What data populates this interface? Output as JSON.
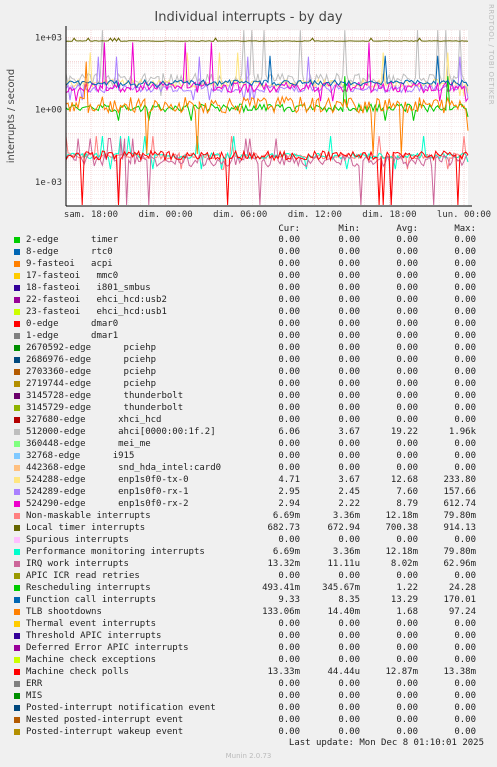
{
  "page": {
    "title": "Individual interrupts - by day",
    "side_label": "RRDTOOL / TOBI OETIKER",
    "last_update": "Last update: Mon Dec  8 01:10:01 2025",
    "munin": "Munin 2.0.73"
  },
  "legend_headers": {
    "cur": "Cur:",
    "min": "Min:",
    "avg": "Avg:",
    "max": "Max:"
  },
  "chart_data": {
    "type": "line",
    "title": "Individual interrupts - by day",
    "ylabel": "interrupts / second",
    "yscale": "log",
    "ylim": [
      0.0001,
      2000
    ],
    "yticks": [
      0.001,
      1,
      1000
    ],
    "ytick_labels": [
      "1e-03",
      "1e+00",
      "1e+03"
    ],
    "x_ticks": [
      "sam. 18:00",
      "dim. 00:00",
      "dim. 06:00",
      "dim. 12:00",
      "dim. 18:00",
      "lun. 00:00"
    ],
    "grid": true,
    "legend_position": "bottom",
    "series": [
      {
        "name": "2-edge      timer",
        "color": "#00cc00",
        "cur": "0.00",
        "min": "0.00",
        "avg": "0.00",
        "max": "0.00"
      },
      {
        "name": "8-edge      rtc0",
        "color": "#0066b3",
        "cur": "0.00",
        "min": "0.00",
        "avg": "0.00",
        "max": "0.00"
      },
      {
        "name": "9-fasteoi   acpi",
        "color": "#ff8000",
        "cur": "0.00",
        "min": "0.00",
        "avg": "0.00",
        "max": "0.00"
      },
      {
        "name": "17-fasteoi   mmc0",
        "color": "#ffcc00",
        "cur": "0.00",
        "min": "0.00",
        "avg": "0.00",
        "max": "0.00"
      },
      {
        "name": "18-fasteoi   i801_smbus",
        "color": "#330099",
        "cur": "0.00",
        "min": "0.00",
        "avg": "0.00",
        "max": "0.00"
      },
      {
        "name": "22-fasteoi   ehci_hcd:usb2",
        "color": "#990099",
        "cur": "0.00",
        "min": "0.00",
        "avg": "0.00",
        "max": "0.00"
      },
      {
        "name": "23-fasteoi   ehci_hcd:usb1",
        "color": "#ccff00",
        "cur": "0.00",
        "min": "0.00",
        "avg": "0.00",
        "max": "0.00"
      },
      {
        "name": "0-edge      dmar0",
        "color": "#ff0000",
        "cur": "0.00",
        "min": "0.00",
        "avg": "0.00",
        "max": "0.00"
      },
      {
        "name": "1-edge      dmar1",
        "color": "#808080",
        "cur": "0.00",
        "min": "0.00",
        "avg": "0.00",
        "max": "0.00"
      },
      {
        "name": "2670592-edge      pciehp",
        "color": "#008f00",
        "cur": "0.00",
        "min": "0.00",
        "avg": "0.00",
        "max": "0.00"
      },
      {
        "name": "2686976-edge      pciehp",
        "color": "#00487d",
        "cur": "0.00",
        "min": "0.00",
        "avg": "0.00",
        "max": "0.00"
      },
      {
        "name": "2703360-edge      pciehp",
        "color": "#b35a00",
        "cur": "0.00",
        "min": "0.00",
        "avg": "0.00",
        "max": "0.00"
      },
      {
        "name": "2719744-edge      pciehp",
        "color": "#b38f00",
        "cur": "0.00",
        "min": "0.00",
        "avg": "0.00",
        "max": "0.00"
      },
      {
        "name": "3145728-edge      thunderbolt",
        "color": "#6b006b",
        "cur": "0.00",
        "min": "0.00",
        "avg": "0.00",
        "max": "0.00"
      },
      {
        "name": "3145729-edge      thunderbolt",
        "color": "#8fb300",
        "cur": "0.00",
        "min": "0.00",
        "avg": "0.00",
        "max": "0.00"
      },
      {
        "name": "327680-edge      xhci_hcd",
        "color": "#b30000",
        "cur": "0.00",
        "min": "0.00",
        "avg": "0.00",
        "max": "0.00"
      },
      {
        "name": "512000-edge      ahci[0000:00:1f.2]",
        "color": "#bebebe",
        "cur": "6.06",
        "min": "3.67",
        "avg": "19.22",
        "max": "1.96k"
      },
      {
        "name": "360448-edge      mei_me",
        "color": "#80ff80",
        "cur": "0.00",
        "min": "0.00",
        "avg": "0.00",
        "max": "0.00"
      },
      {
        "name": "32768-edge      i915",
        "color": "#80c9ff",
        "cur": "0.00",
        "min": "0.00",
        "avg": "0.00",
        "max": "0.00"
      },
      {
        "name": "442368-edge      snd_hda_intel:card0",
        "color": "#ffc080",
        "cur": "0.00",
        "min": "0.00",
        "avg": "0.00",
        "max": "0.00"
      },
      {
        "name": "524288-edge      enp1s0f0-tx-0",
        "color": "#ffe680",
        "cur": "4.71",
        "min": "3.67",
        "avg": "12.68",
        "max": "233.80"
      },
      {
        "name": "524289-edge      enp1s0f0-rx-1",
        "color": "#aa80ff",
        "cur": "2.95",
        "min": "2.45",
        "avg": "7.60",
        "max": "157.66"
      },
      {
        "name": "524290-edge      enp1s0f0-rx-2",
        "color": "#ee00cc",
        "cur": "2.94",
        "min": "2.22",
        "avg": "8.79",
        "max": "612.74"
      },
      {
        "name": "Non-maskable interrupts",
        "color": "#ff8080",
        "cur": "6.69m",
        "min": "3.36m",
        "avg": "12.18m",
        "max": "79.80m"
      },
      {
        "name": "Local timer interrupts",
        "color": "#666600",
        "cur": "682.73",
        "min": "672.94",
        "avg": "700.38",
        "max": "914.13"
      },
      {
        "name": "Spurious interrupts",
        "color": "#ffbfff",
        "cur": "0.00",
        "min": "0.00",
        "avg": "0.00",
        "max": "0.00"
      },
      {
        "name": "Performance monitoring interrupts",
        "color": "#00ffcc",
        "cur": "6.69m",
        "min": "3.36m",
        "avg": "12.18m",
        "max": "79.80m"
      },
      {
        "name": "IRQ work interrupts",
        "color": "#cc6699",
        "cur": "13.32m",
        "min": "11.11u",
        "avg": "8.02m",
        "max": "62.96m"
      },
      {
        "name": "APIC ICR read retries",
        "color": "#999900",
        "cur": "0.00",
        "min": "0.00",
        "avg": "0.00",
        "max": "0.00"
      },
      {
        "name": "Rescheduling interrupts",
        "color": "#00cc00",
        "cur": "493.41m",
        "min": "345.67m",
        "avg": "1.22",
        "max": "24.28"
      },
      {
        "name": "Function call interrupts",
        "color": "#0066b3",
        "cur": "9.33",
        "min": "8.35",
        "avg": "13.29",
        "max": "170.01"
      },
      {
        "name": "TLB shootdowns",
        "color": "#ff8000",
        "cur": "133.06m",
        "min": "14.40m",
        "avg": "1.68",
        "max": "97.24"
      },
      {
        "name": "Thermal event interrupts",
        "color": "#ffcc00",
        "cur": "0.00",
        "min": "0.00",
        "avg": "0.00",
        "max": "0.00"
      },
      {
        "name": "Threshold APIC interrupts",
        "color": "#330099",
        "cur": "0.00",
        "min": "0.00",
        "avg": "0.00",
        "max": "0.00"
      },
      {
        "name": "Deferred Error APIC interrupts",
        "color": "#990099",
        "cur": "0.00",
        "min": "0.00",
        "avg": "0.00",
        "max": "0.00"
      },
      {
        "name": "Machine check exceptions",
        "color": "#ccff00",
        "cur": "0.00",
        "min": "0.00",
        "avg": "0.00",
        "max": "0.00"
      },
      {
        "name": "Machine check polls",
        "color": "#ff0000",
        "cur": "13.33m",
        "min": "44.44u",
        "avg": "12.87m",
        "max": "13.38m"
      },
      {
        "name": "ERR",
        "color": "#808080",
        "cur": "0.00",
        "min": "0.00",
        "avg": "0.00",
        "max": "0.00"
      },
      {
        "name": "MIS",
        "color": "#008f00",
        "cur": "0.00",
        "min": "0.00",
        "avg": "0.00",
        "max": "0.00"
      },
      {
        "name": "Posted-interrupt notification event",
        "color": "#00487d",
        "cur": "0.00",
        "min": "0.00",
        "avg": "0.00",
        "max": "0.00"
      },
      {
        "name": "Nested posted-interrupt event",
        "color": "#b35a00",
        "cur": "0.00",
        "min": "0.00",
        "avg": "0.00",
        "max": "0.00"
      },
      {
        "name": "Posted-interrupt wakeup event",
        "color": "#b38f00",
        "cur": "0.00",
        "min": "0.00",
        "avg": "0.00",
        "max": "0.00"
      }
    ]
  }
}
